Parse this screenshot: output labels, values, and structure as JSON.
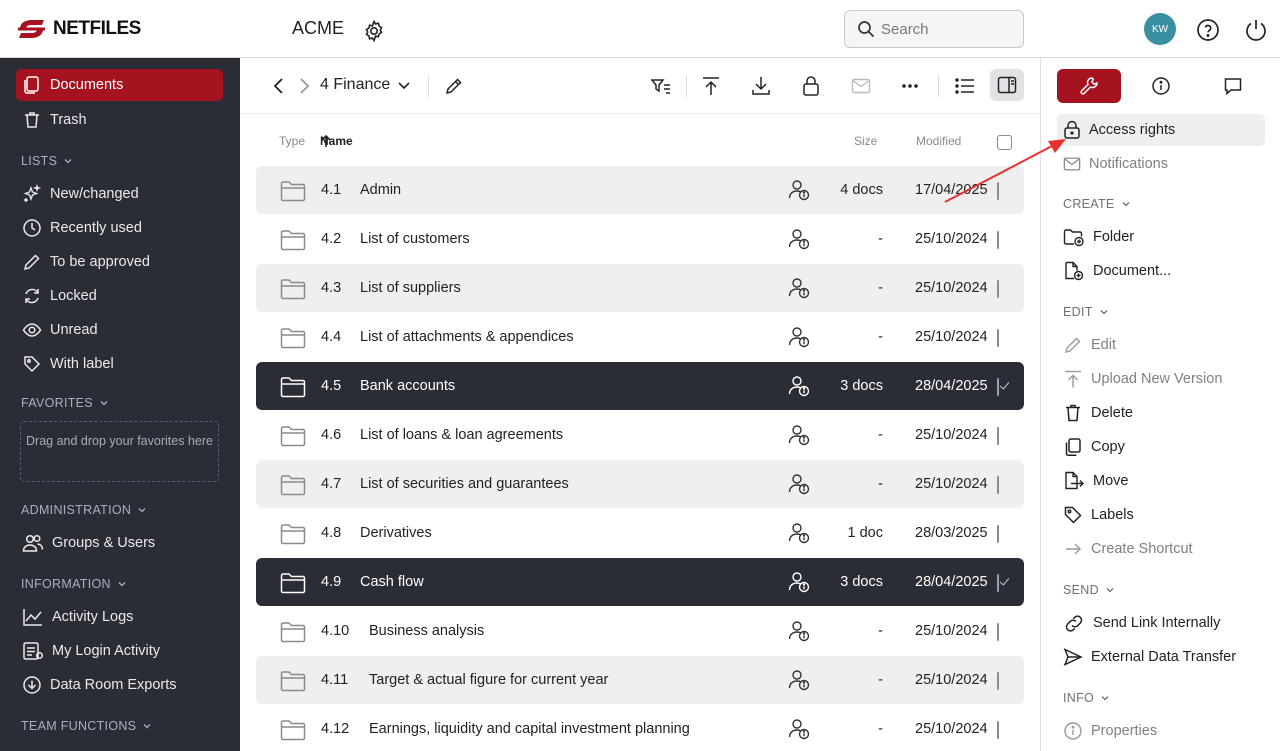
{
  "app": {
    "logo_text": "NETFILES",
    "company": "ACME",
    "search_placeholder": "Search",
    "avatar_initials": "KW",
    "accent": "#a4131f"
  },
  "sidebar": {
    "items_top": [
      {
        "label": "Documents",
        "icon": "documents-icon",
        "active": true
      },
      {
        "label": "Trash",
        "icon": "trash-icon"
      }
    ],
    "lists_label": "LISTS",
    "lists": [
      {
        "label": "New/changed",
        "icon": "sparkle-icon"
      },
      {
        "label": "Recently used",
        "icon": "clock-icon"
      },
      {
        "label": "To be approved",
        "icon": "pencil-icon"
      },
      {
        "label": "Locked",
        "icon": "refresh-icon"
      },
      {
        "label": "Unread",
        "icon": "eye-icon"
      },
      {
        "label": "With label",
        "icon": "tag-icon"
      }
    ],
    "favorites_label": "FAVORITES",
    "favorites_drop": "Drag and drop your favorites here",
    "admin_label": "ADMINISTRATION",
    "admin": [
      {
        "label": "Groups & Users",
        "icon": "users-icon"
      }
    ],
    "info_label": "INFORMATION",
    "info": [
      {
        "label": "Activity Logs",
        "icon": "chart-icon"
      },
      {
        "label": "My Login Activity",
        "icon": "list-icon"
      },
      {
        "label": "Data Room Exports",
        "icon": "download-circle-icon"
      }
    ],
    "team_label": "TEAM FUNCTIONS"
  },
  "main": {
    "folder": "4 Finance",
    "headers": {
      "type": "Type",
      "name": "Name",
      "size": "Size",
      "modified": "Modified"
    },
    "rows": [
      {
        "num": "4.1",
        "name": "Admin",
        "size": "4 docs",
        "date": "17/04/2025",
        "style": "alt"
      },
      {
        "num": "4.2",
        "name": "List of customers",
        "size": "-",
        "date": "25/10/2024",
        "style": ""
      },
      {
        "num": "4.3",
        "name": "List of suppliers",
        "size": "-",
        "date": "25/10/2024",
        "style": "alt"
      },
      {
        "num": "4.4",
        "name": "List of attachments & appendices",
        "size": "-",
        "date": "25/10/2024",
        "style": ""
      },
      {
        "num": "4.5",
        "name": "Bank accounts",
        "size": "3 docs",
        "date": "28/04/2025",
        "style": "sel"
      },
      {
        "num": "4.6",
        "name": "List of loans & loan agreements",
        "size": "-",
        "date": "25/10/2024",
        "style": ""
      },
      {
        "num": "4.7",
        "name": "List of securities and guarantees",
        "size": "-",
        "date": "25/10/2024",
        "style": "alt"
      },
      {
        "num": "4.8",
        "name": "Derivatives",
        "size": "1 doc",
        "date": "28/03/2025",
        "style": ""
      },
      {
        "num": "4.9",
        "name": "Cash flow",
        "size": "3 docs",
        "date": "28/04/2025",
        "style": "sel"
      },
      {
        "num": "4.10",
        "name": "Business analysis",
        "size": "-",
        "date": "25/10/2024",
        "style": ""
      },
      {
        "num": "4.11",
        "name": "Target & actual figure for current year",
        "size": "-",
        "date": "25/10/2024",
        "style": "alt"
      },
      {
        "num": "4.12",
        "name": "Earnings, liquidity and capital investment planning",
        "size": "-",
        "date": "25/10/2024",
        "style": ""
      }
    ]
  },
  "panel": {
    "top_items": [
      {
        "label": "Access rights",
        "icon": "lock-icon",
        "highlight": true
      },
      {
        "label": "Notifications",
        "icon": "mail-icon",
        "dim": true
      }
    ],
    "create_label": "CREATE",
    "create": [
      {
        "label": "Folder",
        "icon": "folder-plus-icon"
      },
      {
        "label": "Document...",
        "icon": "document-plus-icon"
      }
    ],
    "edit_label": "EDIT",
    "edit": [
      {
        "label": "Edit",
        "icon": "pencil-icon",
        "dim": true
      },
      {
        "label": "Upload New Version",
        "icon": "upload-icon",
        "dim": true
      },
      {
        "label": "Delete",
        "icon": "trash-icon"
      },
      {
        "label": "Copy",
        "icon": "copy-icon"
      },
      {
        "label": "Move",
        "icon": "move-icon"
      },
      {
        "label": "Labels",
        "icon": "tag-icon"
      },
      {
        "label": "Create Shortcut",
        "icon": "arrow-right-icon",
        "dim": true
      }
    ],
    "send_label": "SEND",
    "send": [
      {
        "label": "Send Link Internally",
        "icon": "link-icon"
      },
      {
        "label": "External Data Transfer",
        "icon": "send-icon"
      }
    ],
    "info_label": "INFO",
    "info": [
      {
        "label": "Properties",
        "icon": "info-icon",
        "dim": true
      }
    ]
  }
}
